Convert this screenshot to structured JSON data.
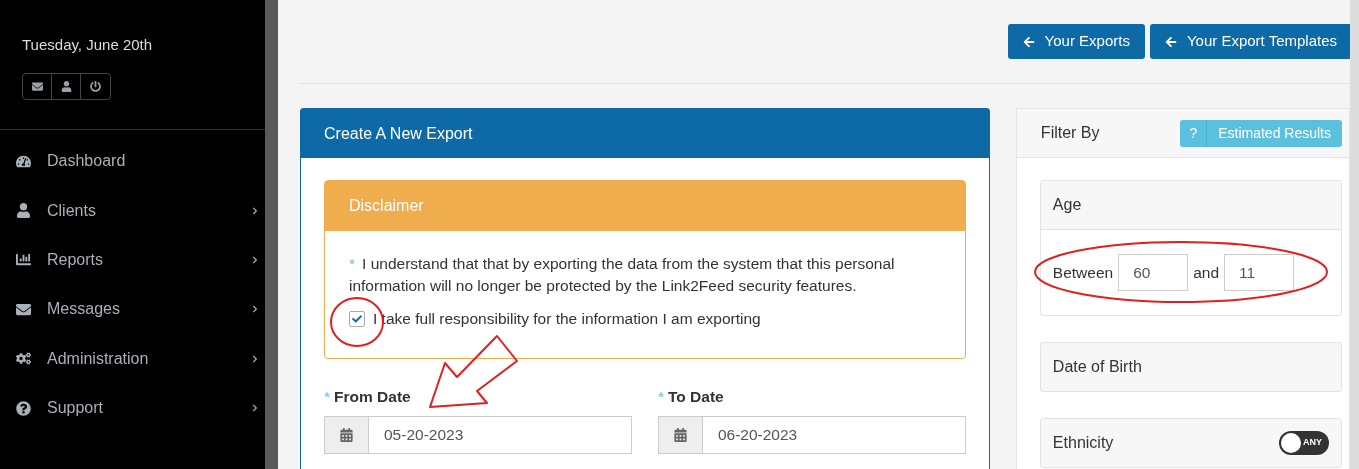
{
  "sidebar": {
    "date": "Tuesday, June 20th",
    "quick_buttons": [
      {
        "kind": "mail"
      },
      {
        "kind": "user"
      },
      {
        "kind": "power"
      }
    ],
    "items": [
      {
        "label": "Dashboard",
        "kind": "dashboard",
        "has_submenu": false
      },
      {
        "label": "Clients",
        "kind": "user",
        "has_submenu": true
      },
      {
        "label": "Reports",
        "kind": "chart",
        "has_submenu": true
      },
      {
        "label": "Messages",
        "kind": "mail",
        "has_submenu": true
      },
      {
        "label": "Administration",
        "kind": "cogs",
        "has_submenu": true
      },
      {
        "label": "Support",
        "kind": "help",
        "has_submenu": true
      }
    ]
  },
  "header_buttons": [
    {
      "label": "Your Exports"
    },
    {
      "label": "Your Export Templates"
    }
  ],
  "export_panel": {
    "title": "Create A New Export",
    "disclaimer": {
      "title": "Disclaimer",
      "required_mark": "*",
      "text": "I understand that that by exporting the data from the system that this personal information will no longer be protected by the Link2Feed security features.",
      "checkbox": {
        "label": "I take full responsibility for the information I am exporting",
        "checked": true
      }
    },
    "dates": [
      {
        "required_mark": "*",
        "label": "From Date",
        "value": "05-20-2023"
      },
      {
        "required_mark": "*",
        "label": "To Date",
        "value": "06-20-2023"
      }
    ]
  },
  "filter_panel": {
    "title": "Filter By",
    "help_mark": "?",
    "results_button": "Estimated Results",
    "sections": [
      {
        "kind": "range",
        "title": "Age",
        "from_label": "Between",
        "from": "60",
        "to_label": "and",
        "to": "11"
      },
      {
        "kind": "plain",
        "title": "Date of Birth"
      },
      {
        "kind": "toggle",
        "title": "Ethnicity",
        "toggle": {
          "label": "ANY",
          "on": false
        }
      }
    ]
  }
}
